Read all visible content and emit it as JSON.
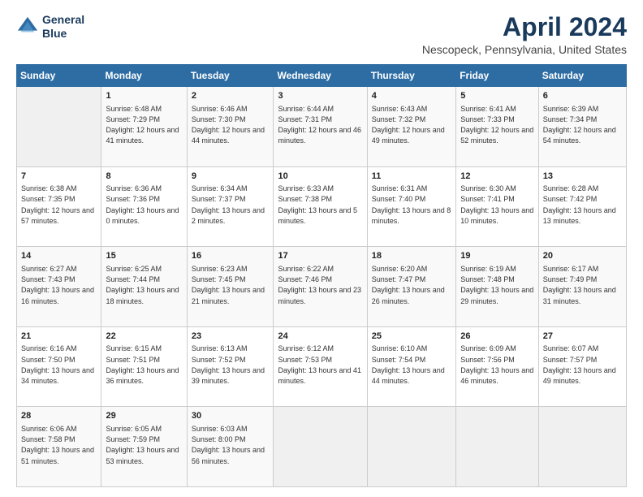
{
  "header": {
    "logo_line1": "General",
    "logo_line2": "Blue",
    "title": "April 2024",
    "subtitle": "Nescopeck, Pennsylvania, United States"
  },
  "columns": [
    "Sunday",
    "Monday",
    "Tuesday",
    "Wednesday",
    "Thursday",
    "Friday",
    "Saturday"
  ],
  "weeks": [
    [
      {
        "day": "",
        "sunrise": "",
        "sunset": "",
        "daylight": ""
      },
      {
        "day": "1",
        "sunrise": "Sunrise: 6:48 AM",
        "sunset": "Sunset: 7:29 PM",
        "daylight": "Daylight: 12 hours and 41 minutes."
      },
      {
        "day": "2",
        "sunrise": "Sunrise: 6:46 AM",
        "sunset": "Sunset: 7:30 PM",
        "daylight": "Daylight: 12 hours and 44 minutes."
      },
      {
        "day": "3",
        "sunrise": "Sunrise: 6:44 AM",
        "sunset": "Sunset: 7:31 PM",
        "daylight": "Daylight: 12 hours and 46 minutes."
      },
      {
        "day": "4",
        "sunrise": "Sunrise: 6:43 AM",
        "sunset": "Sunset: 7:32 PM",
        "daylight": "Daylight: 12 hours and 49 minutes."
      },
      {
        "day": "5",
        "sunrise": "Sunrise: 6:41 AM",
        "sunset": "Sunset: 7:33 PM",
        "daylight": "Daylight: 12 hours and 52 minutes."
      },
      {
        "day": "6",
        "sunrise": "Sunrise: 6:39 AM",
        "sunset": "Sunset: 7:34 PM",
        "daylight": "Daylight: 12 hours and 54 minutes."
      }
    ],
    [
      {
        "day": "7",
        "sunrise": "Sunrise: 6:38 AM",
        "sunset": "Sunset: 7:35 PM",
        "daylight": "Daylight: 12 hours and 57 minutes."
      },
      {
        "day": "8",
        "sunrise": "Sunrise: 6:36 AM",
        "sunset": "Sunset: 7:36 PM",
        "daylight": "Daylight: 13 hours and 0 minutes."
      },
      {
        "day": "9",
        "sunrise": "Sunrise: 6:34 AM",
        "sunset": "Sunset: 7:37 PM",
        "daylight": "Daylight: 13 hours and 2 minutes."
      },
      {
        "day": "10",
        "sunrise": "Sunrise: 6:33 AM",
        "sunset": "Sunset: 7:38 PM",
        "daylight": "Daylight: 13 hours and 5 minutes."
      },
      {
        "day": "11",
        "sunrise": "Sunrise: 6:31 AM",
        "sunset": "Sunset: 7:40 PM",
        "daylight": "Daylight: 13 hours and 8 minutes."
      },
      {
        "day": "12",
        "sunrise": "Sunrise: 6:30 AM",
        "sunset": "Sunset: 7:41 PM",
        "daylight": "Daylight: 13 hours and 10 minutes."
      },
      {
        "day": "13",
        "sunrise": "Sunrise: 6:28 AM",
        "sunset": "Sunset: 7:42 PM",
        "daylight": "Daylight: 13 hours and 13 minutes."
      }
    ],
    [
      {
        "day": "14",
        "sunrise": "Sunrise: 6:27 AM",
        "sunset": "Sunset: 7:43 PM",
        "daylight": "Daylight: 13 hours and 16 minutes."
      },
      {
        "day": "15",
        "sunrise": "Sunrise: 6:25 AM",
        "sunset": "Sunset: 7:44 PM",
        "daylight": "Daylight: 13 hours and 18 minutes."
      },
      {
        "day": "16",
        "sunrise": "Sunrise: 6:23 AM",
        "sunset": "Sunset: 7:45 PM",
        "daylight": "Daylight: 13 hours and 21 minutes."
      },
      {
        "day": "17",
        "sunrise": "Sunrise: 6:22 AM",
        "sunset": "Sunset: 7:46 PM",
        "daylight": "Daylight: 13 hours and 23 minutes."
      },
      {
        "day": "18",
        "sunrise": "Sunrise: 6:20 AM",
        "sunset": "Sunset: 7:47 PM",
        "daylight": "Daylight: 13 hours and 26 minutes."
      },
      {
        "day": "19",
        "sunrise": "Sunrise: 6:19 AM",
        "sunset": "Sunset: 7:48 PM",
        "daylight": "Daylight: 13 hours and 29 minutes."
      },
      {
        "day": "20",
        "sunrise": "Sunrise: 6:17 AM",
        "sunset": "Sunset: 7:49 PM",
        "daylight": "Daylight: 13 hours and 31 minutes."
      }
    ],
    [
      {
        "day": "21",
        "sunrise": "Sunrise: 6:16 AM",
        "sunset": "Sunset: 7:50 PM",
        "daylight": "Daylight: 13 hours and 34 minutes."
      },
      {
        "day": "22",
        "sunrise": "Sunrise: 6:15 AM",
        "sunset": "Sunset: 7:51 PM",
        "daylight": "Daylight: 13 hours and 36 minutes."
      },
      {
        "day": "23",
        "sunrise": "Sunrise: 6:13 AM",
        "sunset": "Sunset: 7:52 PM",
        "daylight": "Daylight: 13 hours and 39 minutes."
      },
      {
        "day": "24",
        "sunrise": "Sunrise: 6:12 AM",
        "sunset": "Sunset: 7:53 PM",
        "daylight": "Daylight: 13 hours and 41 minutes."
      },
      {
        "day": "25",
        "sunrise": "Sunrise: 6:10 AM",
        "sunset": "Sunset: 7:54 PM",
        "daylight": "Daylight: 13 hours and 44 minutes."
      },
      {
        "day": "26",
        "sunrise": "Sunrise: 6:09 AM",
        "sunset": "Sunset: 7:56 PM",
        "daylight": "Daylight: 13 hours and 46 minutes."
      },
      {
        "day": "27",
        "sunrise": "Sunrise: 6:07 AM",
        "sunset": "Sunset: 7:57 PM",
        "daylight": "Daylight: 13 hours and 49 minutes."
      }
    ],
    [
      {
        "day": "28",
        "sunrise": "Sunrise: 6:06 AM",
        "sunset": "Sunset: 7:58 PM",
        "daylight": "Daylight: 13 hours and 51 minutes."
      },
      {
        "day": "29",
        "sunrise": "Sunrise: 6:05 AM",
        "sunset": "Sunset: 7:59 PM",
        "daylight": "Daylight: 13 hours and 53 minutes."
      },
      {
        "day": "30",
        "sunrise": "Sunrise: 6:03 AM",
        "sunset": "Sunset: 8:00 PM",
        "daylight": "Daylight: 13 hours and 56 minutes."
      },
      {
        "day": "",
        "sunrise": "",
        "sunset": "",
        "daylight": ""
      },
      {
        "day": "",
        "sunrise": "",
        "sunset": "",
        "daylight": ""
      },
      {
        "day": "",
        "sunrise": "",
        "sunset": "",
        "daylight": ""
      },
      {
        "day": "",
        "sunrise": "",
        "sunset": "",
        "daylight": ""
      }
    ]
  ]
}
